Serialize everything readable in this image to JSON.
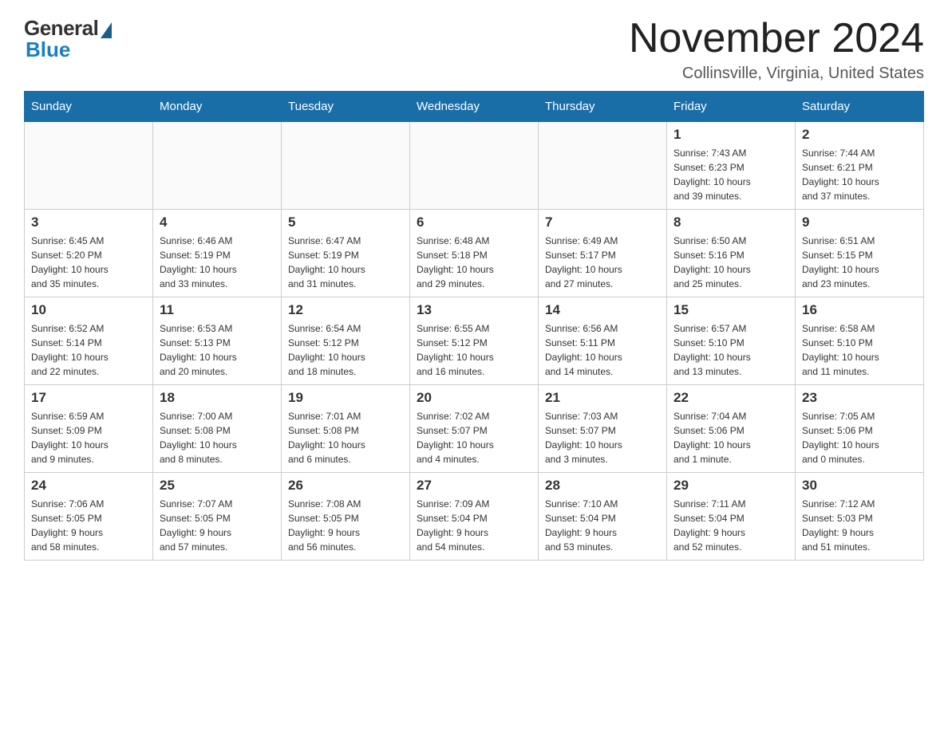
{
  "header": {
    "logo_general": "General",
    "logo_blue": "Blue",
    "month_year": "November 2024",
    "location": "Collinsville, Virginia, United States"
  },
  "weekdays": [
    {
      "label": "Sunday"
    },
    {
      "label": "Monday"
    },
    {
      "label": "Tuesday"
    },
    {
      "label": "Wednesday"
    },
    {
      "label": "Thursday"
    },
    {
      "label": "Friday"
    },
    {
      "label": "Saturday"
    }
  ],
  "weeks": [
    [
      {
        "day": "",
        "info": ""
      },
      {
        "day": "",
        "info": ""
      },
      {
        "day": "",
        "info": ""
      },
      {
        "day": "",
        "info": ""
      },
      {
        "day": "",
        "info": ""
      },
      {
        "day": "1",
        "info": "Sunrise: 7:43 AM\nSunset: 6:23 PM\nDaylight: 10 hours\nand 39 minutes."
      },
      {
        "day": "2",
        "info": "Sunrise: 7:44 AM\nSunset: 6:21 PM\nDaylight: 10 hours\nand 37 minutes."
      }
    ],
    [
      {
        "day": "3",
        "info": "Sunrise: 6:45 AM\nSunset: 5:20 PM\nDaylight: 10 hours\nand 35 minutes."
      },
      {
        "day": "4",
        "info": "Sunrise: 6:46 AM\nSunset: 5:19 PM\nDaylight: 10 hours\nand 33 minutes."
      },
      {
        "day": "5",
        "info": "Sunrise: 6:47 AM\nSunset: 5:19 PM\nDaylight: 10 hours\nand 31 minutes."
      },
      {
        "day": "6",
        "info": "Sunrise: 6:48 AM\nSunset: 5:18 PM\nDaylight: 10 hours\nand 29 minutes."
      },
      {
        "day": "7",
        "info": "Sunrise: 6:49 AM\nSunset: 5:17 PM\nDaylight: 10 hours\nand 27 minutes."
      },
      {
        "day": "8",
        "info": "Sunrise: 6:50 AM\nSunset: 5:16 PM\nDaylight: 10 hours\nand 25 minutes."
      },
      {
        "day": "9",
        "info": "Sunrise: 6:51 AM\nSunset: 5:15 PM\nDaylight: 10 hours\nand 23 minutes."
      }
    ],
    [
      {
        "day": "10",
        "info": "Sunrise: 6:52 AM\nSunset: 5:14 PM\nDaylight: 10 hours\nand 22 minutes."
      },
      {
        "day": "11",
        "info": "Sunrise: 6:53 AM\nSunset: 5:13 PM\nDaylight: 10 hours\nand 20 minutes."
      },
      {
        "day": "12",
        "info": "Sunrise: 6:54 AM\nSunset: 5:12 PM\nDaylight: 10 hours\nand 18 minutes."
      },
      {
        "day": "13",
        "info": "Sunrise: 6:55 AM\nSunset: 5:12 PM\nDaylight: 10 hours\nand 16 minutes."
      },
      {
        "day": "14",
        "info": "Sunrise: 6:56 AM\nSunset: 5:11 PM\nDaylight: 10 hours\nand 14 minutes."
      },
      {
        "day": "15",
        "info": "Sunrise: 6:57 AM\nSunset: 5:10 PM\nDaylight: 10 hours\nand 13 minutes."
      },
      {
        "day": "16",
        "info": "Sunrise: 6:58 AM\nSunset: 5:10 PM\nDaylight: 10 hours\nand 11 minutes."
      }
    ],
    [
      {
        "day": "17",
        "info": "Sunrise: 6:59 AM\nSunset: 5:09 PM\nDaylight: 10 hours\nand 9 minutes."
      },
      {
        "day": "18",
        "info": "Sunrise: 7:00 AM\nSunset: 5:08 PM\nDaylight: 10 hours\nand 8 minutes."
      },
      {
        "day": "19",
        "info": "Sunrise: 7:01 AM\nSunset: 5:08 PM\nDaylight: 10 hours\nand 6 minutes."
      },
      {
        "day": "20",
        "info": "Sunrise: 7:02 AM\nSunset: 5:07 PM\nDaylight: 10 hours\nand 4 minutes."
      },
      {
        "day": "21",
        "info": "Sunrise: 7:03 AM\nSunset: 5:07 PM\nDaylight: 10 hours\nand 3 minutes."
      },
      {
        "day": "22",
        "info": "Sunrise: 7:04 AM\nSunset: 5:06 PM\nDaylight: 10 hours\nand 1 minute."
      },
      {
        "day": "23",
        "info": "Sunrise: 7:05 AM\nSunset: 5:06 PM\nDaylight: 10 hours\nand 0 minutes."
      }
    ],
    [
      {
        "day": "24",
        "info": "Sunrise: 7:06 AM\nSunset: 5:05 PM\nDaylight: 9 hours\nand 58 minutes."
      },
      {
        "day": "25",
        "info": "Sunrise: 7:07 AM\nSunset: 5:05 PM\nDaylight: 9 hours\nand 57 minutes."
      },
      {
        "day": "26",
        "info": "Sunrise: 7:08 AM\nSunset: 5:05 PM\nDaylight: 9 hours\nand 56 minutes."
      },
      {
        "day": "27",
        "info": "Sunrise: 7:09 AM\nSunset: 5:04 PM\nDaylight: 9 hours\nand 54 minutes."
      },
      {
        "day": "28",
        "info": "Sunrise: 7:10 AM\nSunset: 5:04 PM\nDaylight: 9 hours\nand 53 minutes."
      },
      {
        "day": "29",
        "info": "Sunrise: 7:11 AM\nSunset: 5:04 PM\nDaylight: 9 hours\nand 52 minutes."
      },
      {
        "day": "30",
        "info": "Sunrise: 7:12 AM\nSunset: 5:03 PM\nDaylight: 9 hours\nand 51 minutes."
      }
    ]
  ]
}
